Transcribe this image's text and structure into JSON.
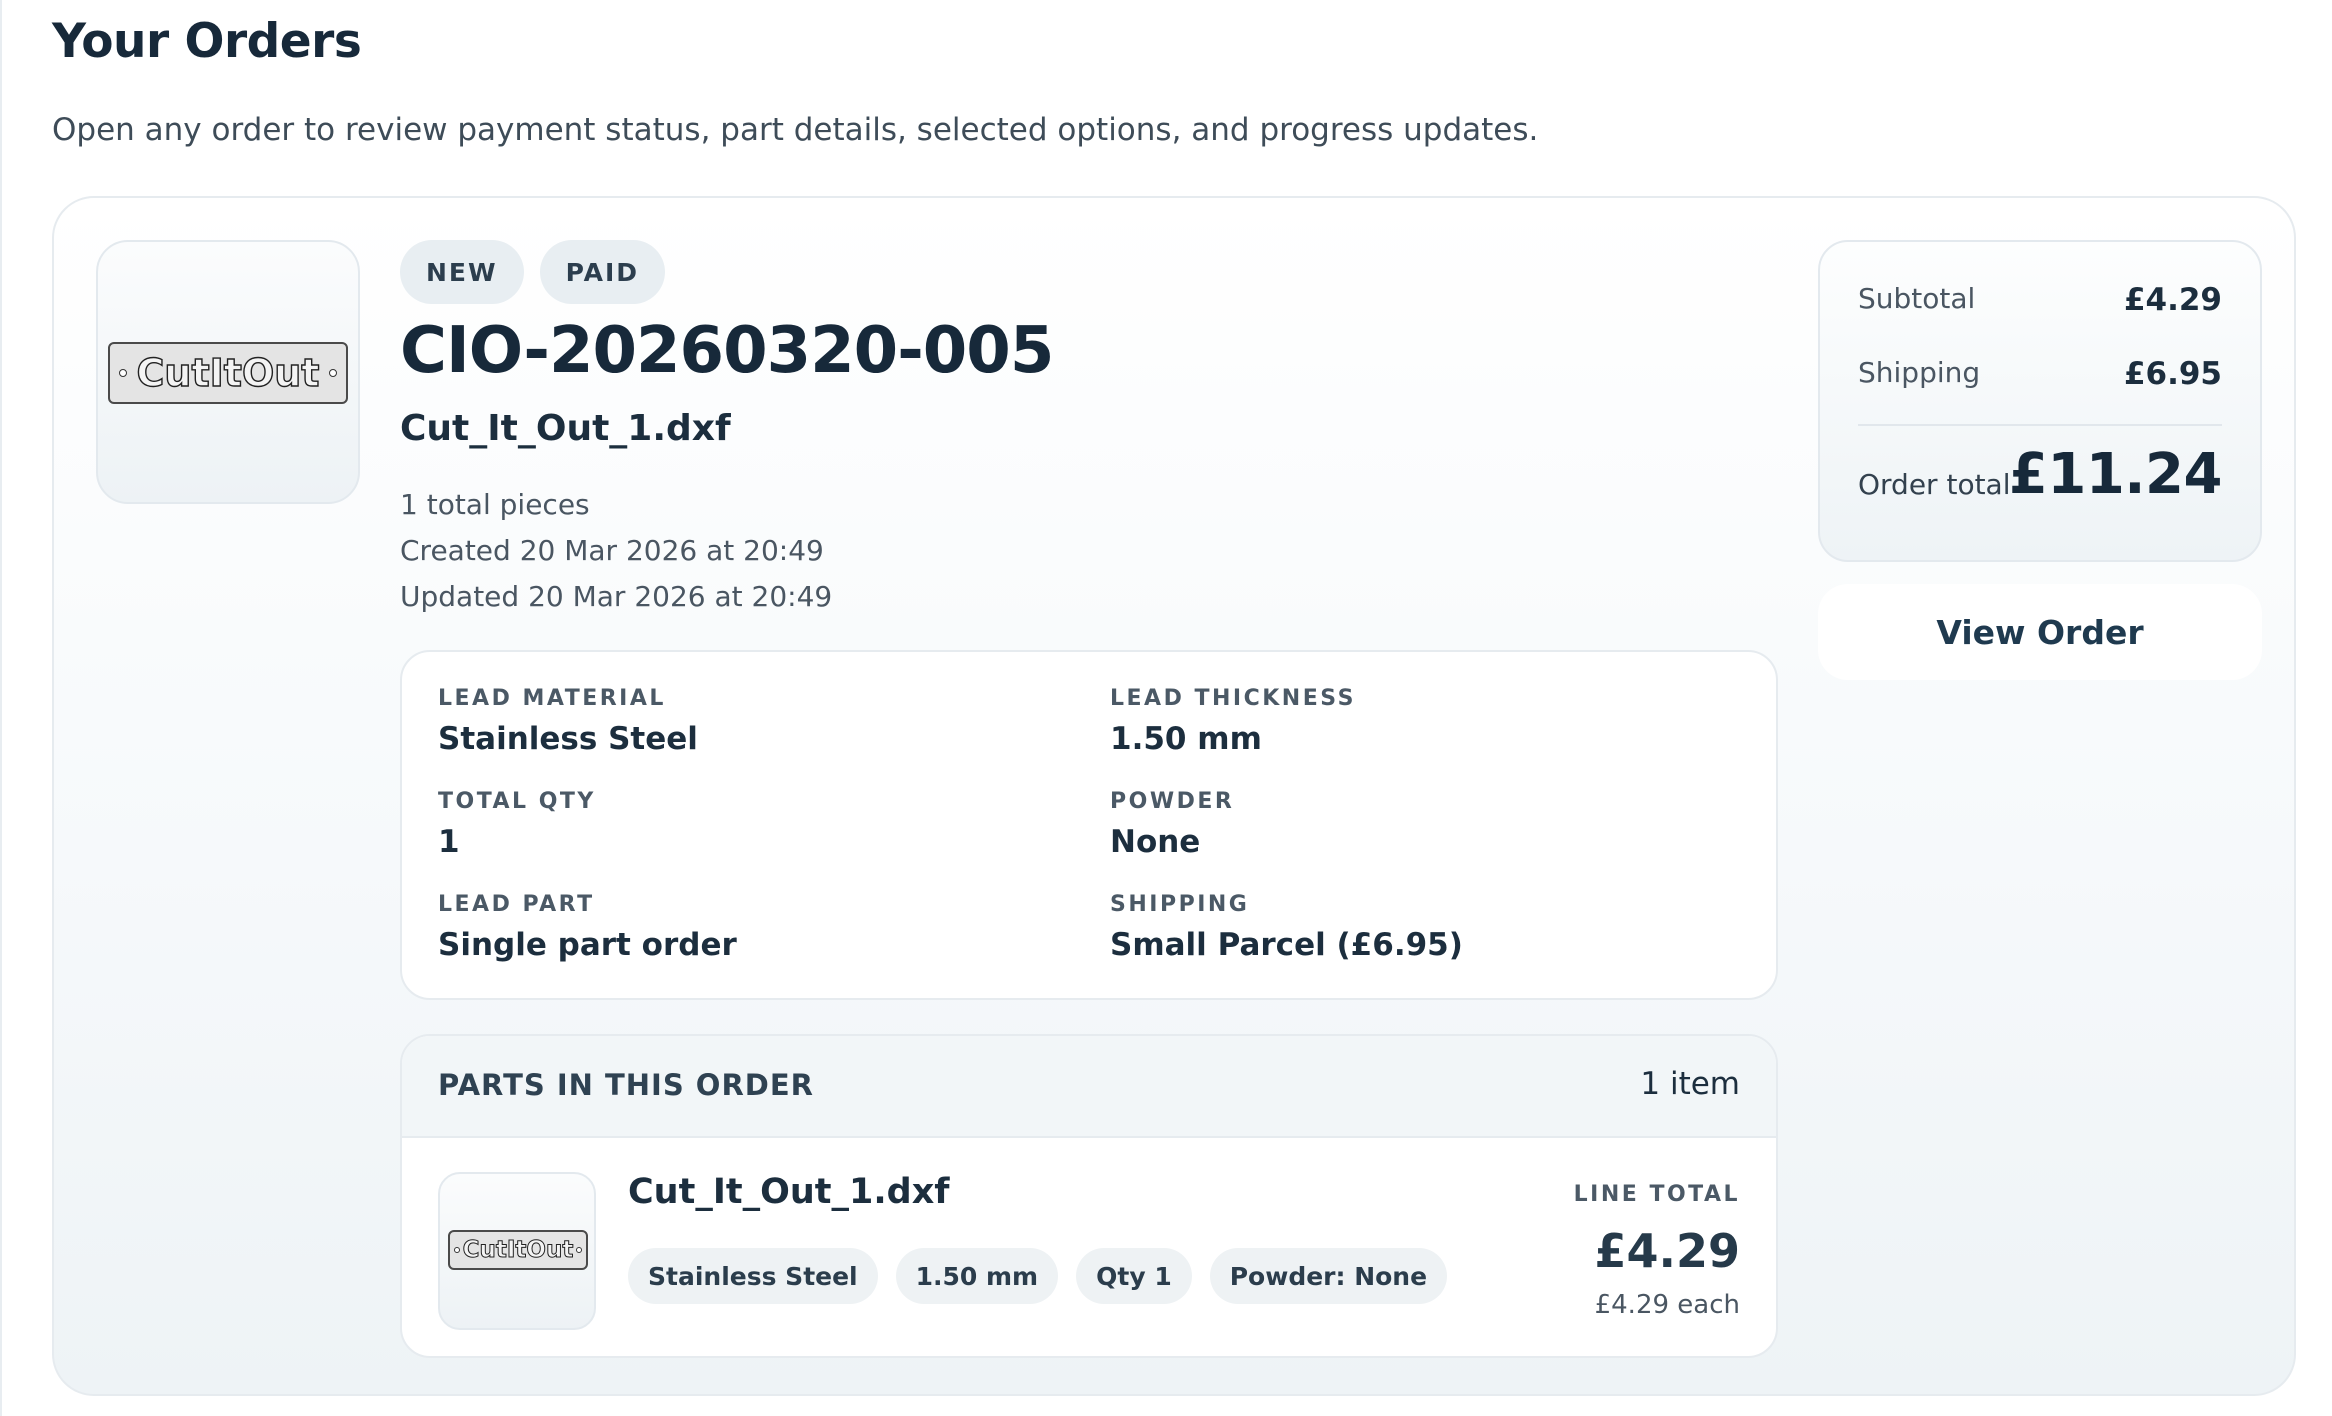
{
  "header": {
    "title": "Your Orders",
    "subtitle": "Open any order to review payment status, part details, selected options, and progress updates."
  },
  "order": {
    "logo_text": "CutItOut",
    "badges": [
      "NEW",
      "PAID"
    ],
    "number": "CIO-20260320-005",
    "file_name": "Cut_It_Out_1.dxf",
    "pieces": "1 total pieces",
    "created": "Created 20 Mar 2026 at 20:49",
    "updated": "Updated 20 Mar 2026 at 20:49",
    "specs": {
      "lead_material": {
        "label": "LEAD MATERIAL",
        "value": "Stainless Steel"
      },
      "lead_thickness": {
        "label": "LEAD THICKNESS",
        "value": "1.50 mm"
      },
      "total_qty": {
        "label": "TOTAL QTY",
        "value": "1"
      },
      "powder": {
        "label": "POWDER",
        "value": "None"
      },
      "lead_part": {
        "label": "LEAD PART",
        "value": "Single part order"
      },
      "shipping": {
        "label": "SHIPPING",
        "value": "Small Parcel (£6.95)"
      }
    },
    "parts": {
      "title": "PARTS IN THIS ORDER",
      "count": "1 item",
      "items": [
        {
          "name": "Cut_It_Out_1.dxf",
          "chips": [
            "Stainless Steel",
            "1.50 mm",
            "Qty 1",
            "Powder: None"
          ],
          "line_total_label": "LINE TOTAL",
          "line_total": "£4.29",
          "each": "£4.29 each"
        }
      ]
    },
    "summary": {
      "subtotal_label": "Subtotal",
      "subtotal": "£4.29",
      "shipping_label": "Shipping",
      "shipping": "£6.95",
      "total_label": "Order total",
      "total": "£11.24"
    },
    "view_button": "View Order"
  }
}
